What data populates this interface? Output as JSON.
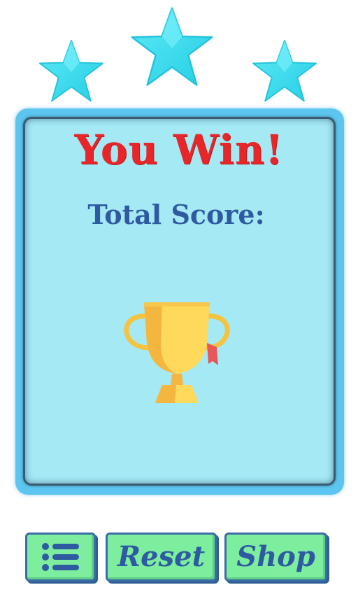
{
  "stars": {
    "earned": 3,
    "total": 3,
    "color": "#3ee3ee",
    "icon": "star-icon"
  },
  "panel": {
    "title": "You Win!",
    "score_label": "Total Score:",
    "score_value": "",
    "trophy_icon": "trophy-icon",
    "title_color": "#e8262a",
    "text_color": "#2e5aa2",
    "background": "#a5e9f5",
    "border_color": "#5cc6f0"
  },
  "buttons": {
    "menu_icon": "menu-list-icon",
    "reset_label": "Reset",
    "shop_label": "Shop",
    "background": "#7ded9e",
    "border_color": "#3a6ca8"
  }
}
